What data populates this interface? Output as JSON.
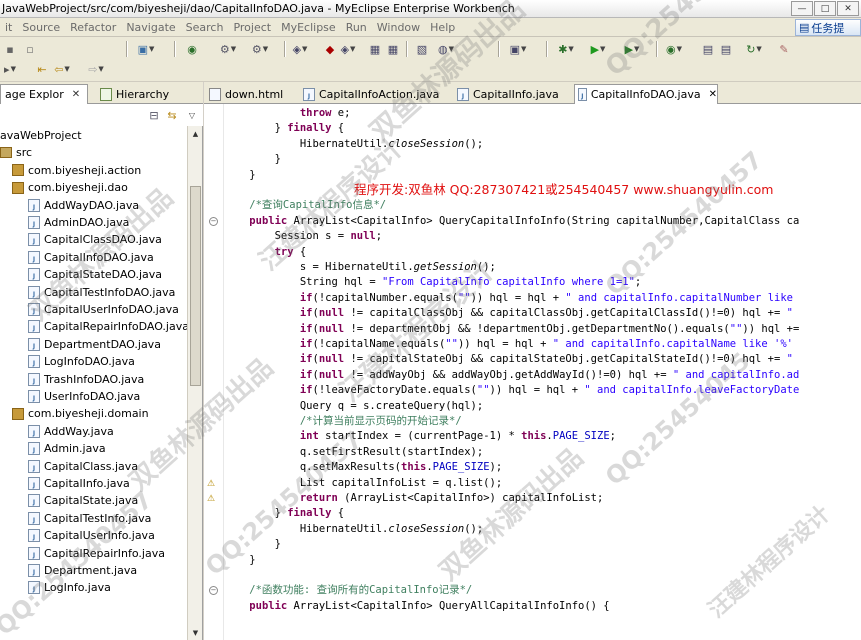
{
  "window": {
    "title": "JavaWebProject/src/com/biyesheji/dao/CapitalInfoDAO.java - MyEclipse Enterprise Workbench",
    "minimize": "—",
    "maximize": "□",
    "close": "✕"
  },
  "menu": {
    "items": [
      "it",
      "Source",
      "Refactor",
      "Navigate",
      "Search",
      "Project",
      "MyEclipse",
      "Run",
      "Window",
      "Help"
    ],
    "task_button": "任务提"
  },
  "left_panel": {
    "tabs": [
      {
        "label": "age Explor",
        "close": "✕"
      },
      {
        "label": "Hierarchy"
      }
    ],
    "tree": [
      {
        "label": "avaWebProject",
        "kind": "project",
        "level": 0
      },
      {
        "label": "src",
        "kind": "folder",
        "level": 0
      },
      {
        "label": "com.biyesheji.action",
        "kind": "package",
        "level": 1
      },
      {
        "label": "com.biyesheji.dao",
        "kind": "package",
        "level": 1
      },
      {
        "label": "AddWayDAO.java",
        "kind": "file",
        "level": 2
      },
      {
        "label": "AdminDAO.java",
        "kind": "file",
        "level": 2
      },
      {
        "label": "CapitalClassDAO.java",
        "kind": "file",
        "level": 2
      },
      {
        "label": "CapitalInfoDAO.java",
        "kind": "file",
        "level": 2
      },
      {
        "label": "CapitalStateDAO.java",
        "kind": "file",
        "level": 2
      },
      {
        "label": "CapitalTestInfoDAO.java",
        "kind": "file",
        "level": 2
      },
      {
        "label": "CapitalUserInfoDAO.java",
        "kind": "file",
        "level": 2
      },
      {
        "label": "CapitalRepairInfoDAO.java",
        "kind": "file",
        "level": 2
      },
      {
        "label": "DepartmentDAO.java",
        "kind": "file",
        "level": 2
      },
      {
        "label": "LogInfoDAO.java",
        "kind": "file",
        "level": 2
      },
      {
        "label": "TrashInfoDAO.java",
        "kind": "file",
        "level": 2
      },
      {
        "label": "UserInfoDAO.java",
        "kind": "file",
        "level": 2
      },
      {
        "label": "com.biyesheji.domain",
        "kind": "package",
        "level": 1
      },
      {
        "label": "AddWay.java",
        "kind": "file",
        "level": 2
      },
      {
        "label": "Admin.java",
        "kind": "file",
        "level": 2
      },
      {
        "label": "CapitalClass.java",
        "kind": "file",
        "level": 2
      },
      {
        "label": "CapitalInfo.java",
        "kind": "file",
        "level": 2
      },
      {
        "label": "CapitalState.java",
        "kind": "file",
        "level": 2
      },
      {
        "label": "CapitalTestInfo.java",
        "kind": "file",
        "level": 2
      },
      {
        "label": "CapitalUserInfo.java",
        "kind": "file",
        "level": 2
      },
      {
        "label": "CapitalRepairInfo.java",
        "kind": "file",
        "level": 2
      },
      {
        "label": "Department.java",
        "kind": "file",
        "level": 2
      },
      {
        "label": "LogInfo.java",
        "kind": "file",
        "level": 2
      }
    ]
  },
  "editor": {
    "tabs": [
      {
        "label": "down.html"
      },
      {
        "label": "CapitalInfoAction.java"
      },
      {
        "label": "CapitalInfo.java"
      },
      {
        "label": "CapitalInfoDAO.java",
        "active": true,
        "close": "✕"
      }
    ],
    "overlay_text": "程序开发:双鱼林 QQ:287307421或254540457 www.shuangyulin.com",
    "lines": [
      [
        [
          "",
          "            "
        ],
        [
          "kw",
          "throw"
        ],
        [
          "",
          " e;"
        ]
      ],
      [
        [
          "",
          "        } "
        ],
        [
          "kw",
          "finally"
        ],
        [
          "",
          " {"
        ]
      ],
      [
        [
          "",
          "            HibernateUtil."
        ],
        [
          "it",
          "closeSession"
        ],
        [
          "",
          "();"
        ]
      ],
      [
        [
          "",
          "        }"
        ]
      ],
      [
        [
          "",
          "    }"
        ]
      ],
      [
        [
          "",
          ""
        ]
      ],
      [
        [
          "cmt",
          "    /*查询CapitalInfo信息*/"
        ]
      ],
      [
        [
          "",
          "    "
        ],
        [
          "kw",
          "public"
        ],
        [
          "",
          " ArrayList<CapitalInfo> QueryCapitalInfoInfo(String capitalNumber,CapitalClass ca"
        ]
      ],
      [
        [
          "",
          "        Session s = "
        ],
        [
          "kw",
          "null"
        ],
        [
          "",
          ";"
        ]
      ],
      [
        [
          "",
          "        "
        ],
        [
          "kw",
          "try"
        ],
        [
          "",
          " {"
        ]
      ],
      [
        [
          "",
          "            s = HibernateUtil."
        ],
        [
          "it",
          "getSession"
        ],
        [
          "",
          "();"
        ]
      ],
      [
        [
          "",
          "            String hql = "
        ],
        [
          "str",
          "\"From CapitalInfo capitalInfo where 1=1\""
        ],
        [
          "",
          ";"
        ]
      ],
      [
        [
          "",
          "            "
        ],
        [
          "kw",
          "if"
        ],
        [
          "",
          "(!capitalNumber.equals("
        ],
        [
          "str",
          "\"\""
        ],
        [
          "",
          ")) hql = hql + "
        ],
        [
          "str",
          "\" and capitalInfo.capitalNumber like"
        ]
      ],
      [
        [
          "",
          "            "
        ],
        [
          "kw",
          "if"
        ],
        [
          "",
          "("
        ],
        [
          "kw",
          "null"
        ],
        [
          "",
          " != capitalClassObj && capitalClassObj.getCapitalClassId()!=0) hql += "
        ],
        [
          "str",
          "\""
        ]
      ],
      [
        [
          "",
          "            "
        ],
        [
          "kw",
          "if"
        ],
        [
          "",
          "("
        ],
        [
          "kw",
          "null"
        ],
        [
          "",
          " != departmentObj && !departmentObj.getDepartmentNo().equals("
        ],
        [
          "str",
          "\"\""
        ],
        [
          "",
          ")) hql +="
        ]
      ],
      [
        [
          "",
          "            "
        ],
        [
          "kw",
          "if"
        ],
        [
          "",
          "(!capitalName.equals("
        ],
        [
          "str",
          "\"\""
        ],
        [
          "",
          ")) hql = hql + "
        ],
        [
          "str",
          "\" and capitalInfo.capitalName like '%'"
        ]
      ],
      [
        [
          "",
          "            "
        ],
        [
          "kw",
          "if"
        ],
        [
          "",
          "("
        ],
        [
          "kw",
          "null"
        ],
        [
          "",
          " != capitalStateObj && capitalStateObj.getCapitalStateId()!=0) hql += "
        ],
        [
          "str",
          "\""
        ]
      ],
      [
        [
          "",
          "            "
        ],
        [
          "kw",
          "if"
        ],
        [
          "",
          "("
        ],
        [
          "kw",
          "null"
        ],
        [
          "",
          " != addWayObj && addWayObj.getAddWayId()!=0) hql += "
        ],
        [
          "str",
          "\" and capitalInfo.ad"
        ]
      ],
      [
        [
          "",
          "            "
        ],
        [
          "kw",
          "if"
        ],
        [
          "",
          "(!leaveFactoryDate.equals("
        ],
        [
          "str",
          "\"\""
        ],
        [
          "",
          ")) hql = hql + "
        ],
        [
          "str",
          "\" and capitalInfo.leaveFactoryDate"
        ]
      ],
      [
        [
          "",
          "            Query q = s.createQuery(hql);"
        ]
      ],
      [
        [
          "cmt",
          "            /*计算当前显示页码的开始记录*/"
        ]
      ],
      [
        [
          "",
          "            "
        ],
        [
          "kw",
          "int"
        ],
        [
          "",
          " startIndex = (currentPage-1) * "
        ],
        [
          "kw",
          "this"
        ],
        [
          "",
          "."
        ],
        [
          "fld",
          "PAGE_SIZE"
        ],
        [
          "",
          ";"
        ]
      ],
      [
        [
          "",
          "            q.setFirstResult(startIndex);"
        ]
      ],
      [
        [
          "",
          "            q.setMaxResults("
        ],
        [
          "kw",
          "this"
        ],
        [
          "",
          "."
        ],
        [
          "fld",
          "PAGE_SIZE"
        ],
        [
          "",
          ");"
        ]
      ],
      [
        [
          "",
          "            List capitalInfoList = q.list();"
        ]
      ],
      [
        [
          "",
          "            "
        ],
        [
          "kw",
          "return"
        ],
        [
          "",
          " (ArrayList<CapitalInfo>) capitalInfoList;"
        ]
      ],
      [
        [
          "",
          "        } "
        ],
        [
          "kw",
          "finally"
        ],
        [
          "",
          " {"
        ]
      ],
      [
        [
          "",
          "            HibernateUtil."
        ],
        [
          "it",
          "closeSession"
        ],
        [
          "",
          "();"
        ]
      ],
      [
        [
          "",
          "        }"
        ]
      ],
      [
        [
          "",
          "    }"
        ]
      ],
      [
        [
          "",
          ""
        ]
      ],
      [
        [
          "cmt",
          "    /*函数功能: 查询所有的CapitalInfo记录*/"
        ]
      ],
      [
        [
          "",
          "    "
        ],
        [
          "kw",
          "public"
        ],
        [
          "",
          " ArrayList<CapitalInfo> QueryAllCapitalInfoInfo() {"
        ]
      ]
    ]
  },
  "watermarks": [
    "QQ:25454045",
    "双鱼林源码出品",
    "汪建林程序设计",
    "QQ:254540457",
    "双鱼林源码出品",
    "汪建林程序设计",
    "QQ:25454045",
    "QQ:254540457",
    "双鱼林源码出品",
    "汪建林程序设计",
    "QQ:254540457",
    "双鱼林源码出品"
  ],
  "colors": {
    "keyword": "#7f0055",
    "string": "#2a00ff",
    "comment": "#3f7f5f",
    "field": "#0000c0",
    "overlay": "#e01010"
  }
}
